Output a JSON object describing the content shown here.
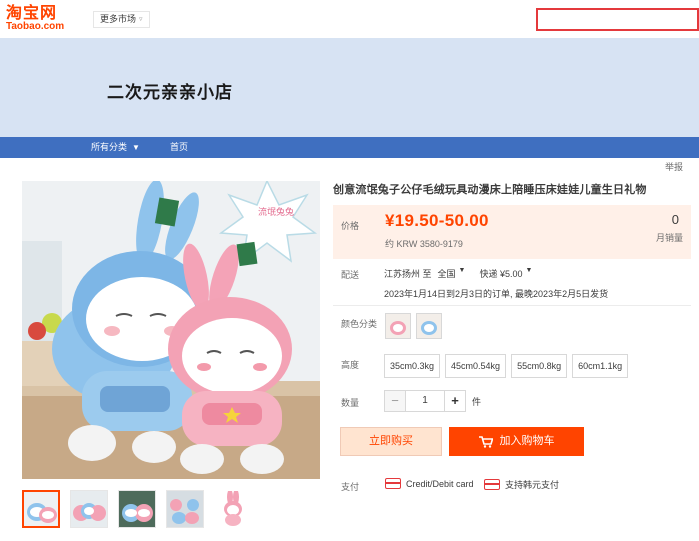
{
  "header": {
    "logo_cn": "淘宝网",
    "logo_en": "Taobao.com",
    "market_label": "更多市场",
    "search_placeholder": ""
  },
  "shop": {
    "name": "二次元亲亲小店"
  },
  "nav": {
    "categories_label": "所有分类",
    "home_label": "首页"
  },
  "report_label": "举报",
  "product": {
    "title": "创意流氓兔子公仔毛绒玩具动漫床上陪睡压床娃娃儿童生日礼物",
    "image_tag": "流氓兔兔",
    "price_label": "价格",
    "price": "¥19.50-50.00",
    "price_krw": "约 KRW 3580-9179",
    "monthly_sales_value": "0",
    "monthly_sales_label": "月销量",
    "shipping_label": "配送",
    "ship_from": "江苏扬州 至",
    "ship_to": "全国",
    "express": "快递 ¥5.00",
    "ship_date_note": "2023年1月14日到2月3日的订单, 最晚2023年2月5日发货",
    "color_label": "颜色分类",
    "height_label": "高度",
    "sizes": [
      "35cm0.3kg",
      "45cm0.54kg",
      "55cm0.8kg",
      "60cm1.1kg"
    ],
    "quantity_label": "数量",
    "quantity": "1",
    "quantity_unit": "件",
    "buy_now_label": "立即购买",
    "add_cart_label": "加入购物车",
    "payment_label": "支付",
    "payment_card": "Credit/Debit card",
    "payment_krw": "支持韩元支付"
  },
  "colors": {
    "accent": "#ff4400",
    "nav_bg": "#3f6fc0",
    "banner_bg": "#d7e3f3",
    "price_bg": "#fff0e8"
  },
  "icons": {
    "search": "search-box",
    "cart": "cart-icon",
    "card": "credit-card-icon",
    "dropdown": "chevron-down-icon"
  }
}
